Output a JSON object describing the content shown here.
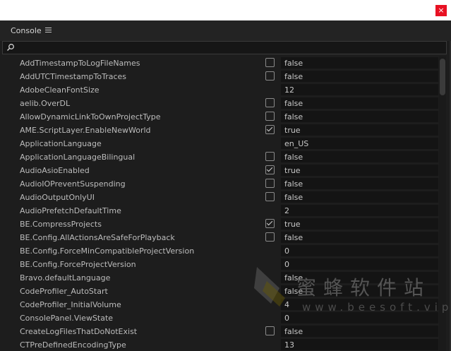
{
  "window": {
    "close_icon": "close-icon",
    "close_glyph": "×"
  },
  "panel": {
    "title": "Console",
    "menu_icon": "hamburger-menu-icon"
  },
  "search": {
    "value": "",
    "icon": "search-icon"
  },
  "watermark": {
    "text": "蜜蜂软件站",
    "url": "www.beesoft.vip"
  },
  "rows": [
    {
      "name": "AddTimestampToLogFileNames",
      "checkbox": true,
      "checked": false,
      "value": "false"
    },
    {
      "name": "AddUTCTimestampToTraces",
      "checkbox": true,
      "checked": false,
      "value": "false"
    },
    {
      "name": "AdobeCleanFontSize",
      "checkbox": false,
      "checked": false,
      "value": "12"
    },
    {
      "name": "aelib.OverDL",
      "checkbox": true,
      "checked": false,
      "value": "false"
    },
    {
      "name": "AllowDynamicLinkToOwnProjectType",
      "checkbox": true,
      "checked": false,
      "value": "false"
    },
    {
      "name": "AME.ScriptLayer.EnableNewWorld",
      "checkbox": true,
      "checked": true,
      "value": "true"
    },
    {
      "name": "ApplicationLanguage",
      "checkbox": false,
      "checked": false,
      "value": "en_US"
    },
    {
      "name": "ApplicationLanguageBilingual",
      "checkbox": true,
      "checked": false,
      "value": "false"
    },
    {
      "name": "AudioAsioEnabled",
      "checkbox": true,
      "checked": true,
      "value": "true"
    },
    {
      "name": "AudioIOPreventSuspending",
      "checkbox": true,
      "checked": false,
      "value": "false"
    },
    {
      "name": "AudioOutputOnlyUI",
      "checkbox": true,
      "checked": false,
      "value": "false"
    },
    {
      "name": "AudioPrefetchDefaultTime",
      "checkbox": false,
      "checked": false,
      "value": "2"
    },
    {
      "name": "BE.CompressProjects",
      "checkbox": true,
      "checked": true,
      "value": "true"
    },
    {
      "name": "BE.Config.AllActionsAreSafeForPlayback",
      "checkbox": true,
      "checked": false,
      "value": "false"
    },
    {
      "name": "BE.Config.ForceMinCompatibleProjectVersion",
      "checkbox": false,
      "checked": false,
      "value": "0"
    },
    {
      "name": "BE.Config.ForceProjectVersion",
      "checkbox": false,
      "checked": false,
      "value": "0"
    },
    {
      "name": "Bravo.defaultLanguage",
      "checkbox": false,
      "checked": false,
      "value": "false"
    },
    {
      "name": "CodeProfiler_AutoStart",
      "checkbox": false,
      "checked": false,
      "value": "false"
    },
    {
      "name": "CodeProfiler_InitialVolume",
      "checkbox": false,
      "checked": false,
      "value": "4"
    },
    {
      "name": "ConsolePanel.ViewState",
      "checkbox": false,
      "checked": false,
      "value": "0"
    },
    {
      "name": "CreateLogFilesThatDoNotExist",
      "checkbox": true,
      "checked": false,
      "value": "false"
    },
    {
      "name": "CTPreDefinedEncodingType",
      "checkbox": false,
      "checked": false,
      "value": "13"
    }
  ]
}
